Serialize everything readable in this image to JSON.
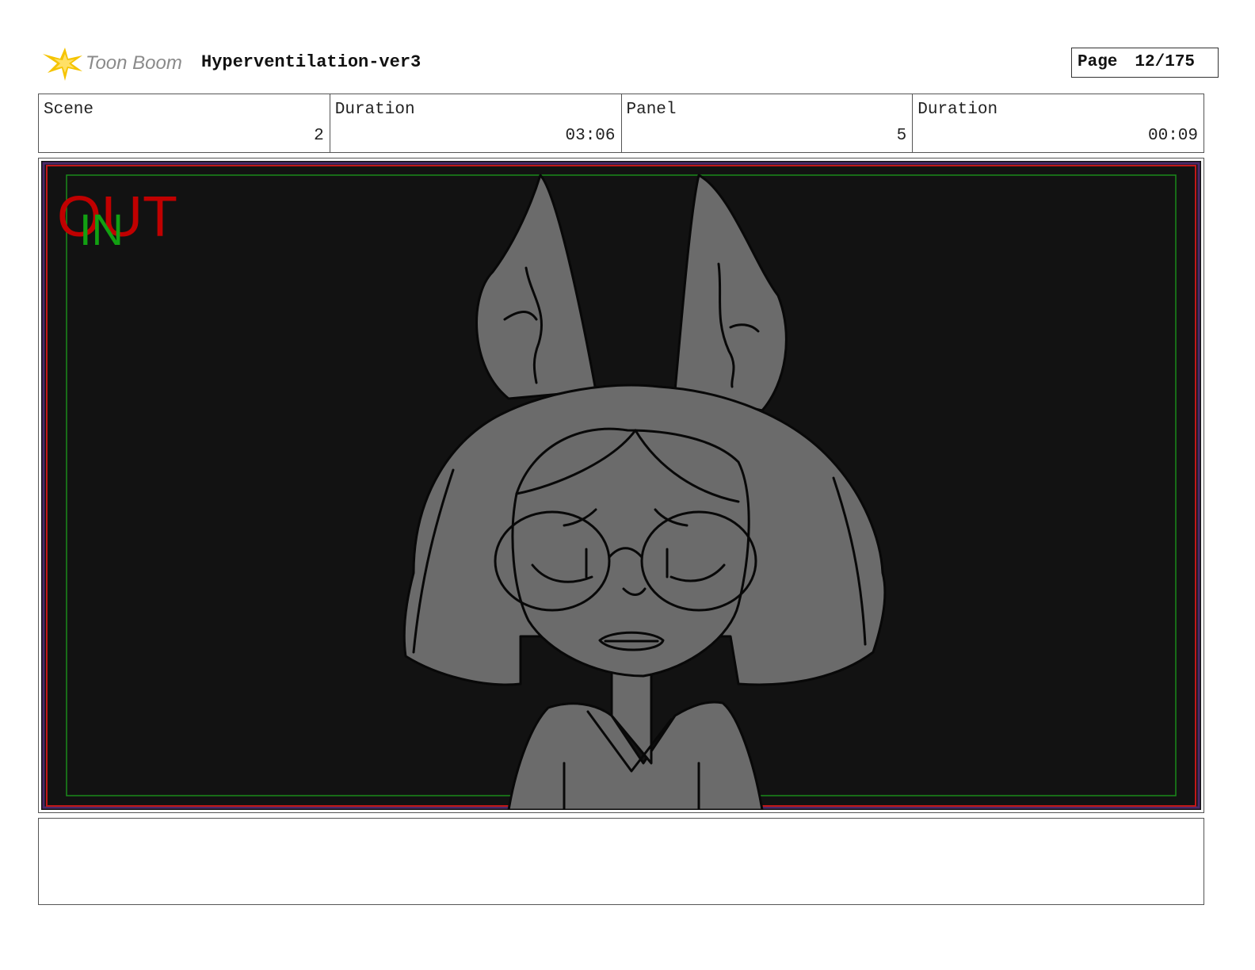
{
  "header": {
    "logo_text": "Toon Boom",
    "project_title": "Hyperventilation-ver3",
    "page_label": "Page",
    "page_number": "12/175"
  },
  "info": {
    "scene_label": "Scene",
    "scene_value": "2",
    "scene_duration_label": "Duration",
    "scene_duration_value": "03:06",
    "panel_label": "Panel",
    "panel_value": "5",
    "panel_duration_label": "Duration",
    "panel_duration_value": "00:09"
  },
  "frame": {
    "out_marker": "OUT",
    "in_marker": "IN",
    "background_color": "#121212",
    "character_fill": "#6b6b6b",
    "out_color": "#c00000",
    "in_color": "#12a012"
  },
  "notes": {
    "text": ""
  }
}
